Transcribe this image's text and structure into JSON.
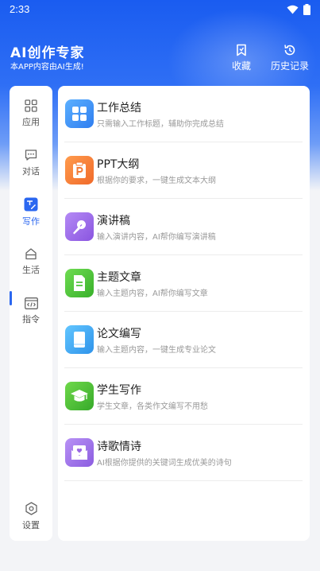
{
  "status_bar": {
    "time": "2:33"
  },
  "header": {
    "title": "AI创作专家",
    "subtitle": "本APP内容由AI生成!",
    "favorites_label": "收藏",
    "history_label": "历史记录"
  },
  "sidebar": {
    "items": [
      {
        "label": "应用",
        "icon": "grid-icon"
      },
      {
        "label": "对话",
        "icon": "chat-icon"
      },
      {
        "label": "写作",
        "icon": "edit-icon",
        "active": true
      },
      {
        "label": "生活",
        "icon": "home-icon"
      },
      {
        "label": "指令",
        "icon": "code-icon"
      }
    ],
    "settings_label": "设置"
  },
  "cards": [
    {
      "title": "工作总结",
      "desc": "只需输入工作标题，辅助你完成总结",
      "color": "#3d8ff2"
    },
    {
      "title": "PPT大纲",
      "desc": "根据你的要求，一键生成文本大纲",
      "color": "#f37a35"
    },
    {
      "title": "演讲稿",
      "desc": "输入演讲内容，AI帮你编写演讲稿",
      "color": "#9a63e6"
    },
    {
      "title": "主题文章",
      "desc": "输入主题内容，AI帮你编写文章",
      "color": "#4fc23a"
    },
    {
      "title": "论文编写",
      "desc": "输入主题内容，一键生成专业论文",
      "color": "#3aa6ef"
    },
    {
      "title": "学生写作",
      "desc": "学生文章，各类作文编写不用愁",
      "color": "#48b83a"
    },
    {
      "title": "诗歌情诗",
      "desc": "AI根据你提供的关键词生成优美的诗句",
      "color": "#9a68e3"
    }
  ]
}
